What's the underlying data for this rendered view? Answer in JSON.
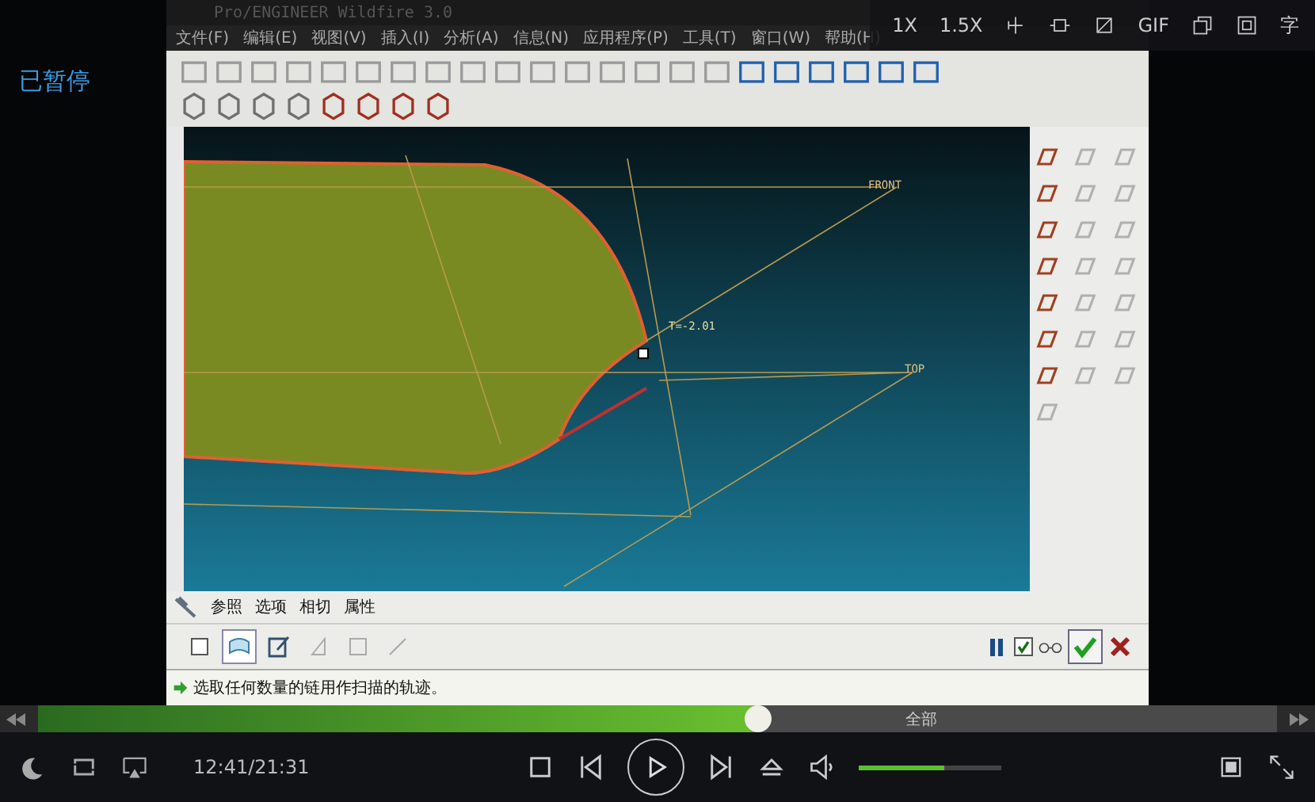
{
  "player": {
    "status": "已暂停",
    "speeds": [
      "1X",
      "1.5X"
    ],
    "gif": "GIF",
    "subtitle": "字",
    "time": "12:41/21:31",
    "paused": true,
    "progress": {
      "level": 0.58
    },
    "progress_label": "全部",
    "volume": {
      "level": 0.6
    }
  },
  "app": {
    "title": "Pro/ENGINEER Wildfire 3.0",
    "menu": [
      "文件(F)",
      "编辑(E)",
      "视图(V)",
      "插入(I)",
      "分析(A)",
      "信息(N)",
      "应用程序(P)",
      "工具(T)",
      "窗口(W)",
      "帮助(H)"
    ],
    "canvas_labels": [
      "FRONT",
      "T=-2.01",
      "TOP"
    ],
    "dashboard_tabs": [
      "参照",
      "选项",
      "相切",
      "属性"
    ],
    "sweep_tools": [
      {
        "kind": "solid",
        "selected": false
      },
      {
        "kind": "surface",
        "selected": true
      },
      {
        "kind": "sketch",
        "selected": false
      },
      {
        "kind": "trim",
        "selected": false
      },
      {
        "kind": "thicken",
        "selected": false
      },
      {
        "kind": "line",
        "selected": false
      }
    ],
    "preview_checked": true,
    "message": "选取任何数量的链用作扫描的轨迹。"
  }
}
